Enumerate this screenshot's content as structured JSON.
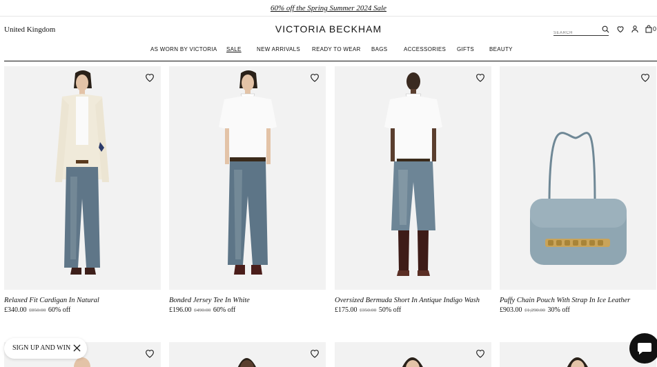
{
  "promo": {
    "text": "60% off the Spring Summer 2024 Sale"
  },
  "header": {
    "region": "United Kingdom",
    "logo": "VICTORIA BECKHAM",
    "search_placeholder": "SEARCH",
    "bag_count": "0",
    "icons": [
      "search-icon",
      "heart-icon",
      "account-icon",
      "bag-icon"
    ]
  },
  "nav": [
    {
      "label": "AS WORN BY VICTORIA",
      "active": false
    },
    {
      "label": "SALE",
      "active": true
    },
    {
      "label": "NEW ARRIVALS",
      "active": false
    },
    {
      "label": "READY TO WEAR",
      "active": false
    },
    {
      "label": "BAGS",
      "active": false
    },
    {
      "label": "ACCESSORIES",
      "active": false
    },
    {
      "label": "GIFTS",
      "active": false
    },
    {
      "label": "BEAUTY",
      "active": false
    }
  ],
  "products": [
    {
      "name": "Relaxed Fit Cardigan In Natural",
      "price": "£340.00",
      "old_price": "£850.00",
      "discount": "60% off"
    },
    {
      "name": "Bonded Jersey Tee In White",
      "price": "£196.00",
      "old_price": "£490.00",
      "discount": "60% off"
    },
    {
      "name": "Oversized Bermuda Short In Antique Indigo Wash",
      "price": "£175.00",
      "old_price": "£350.00",
      "discount": "50% off"
    },
    {
      "name": "Puffy Chain Pouch With Strap In Ice Leather",
      "price": "£903.00",
      "old_price": "£1,290.00",
      "discount": "30% off"
    }
  ],
  "signup": {
    "label": "SIGN UP AND WIN"
  },
  "colors": {
    "denim": "#5f7688",
    "bag_blue": "#8fa6b2",
    "chat_bg": "#111111"
  }
}
